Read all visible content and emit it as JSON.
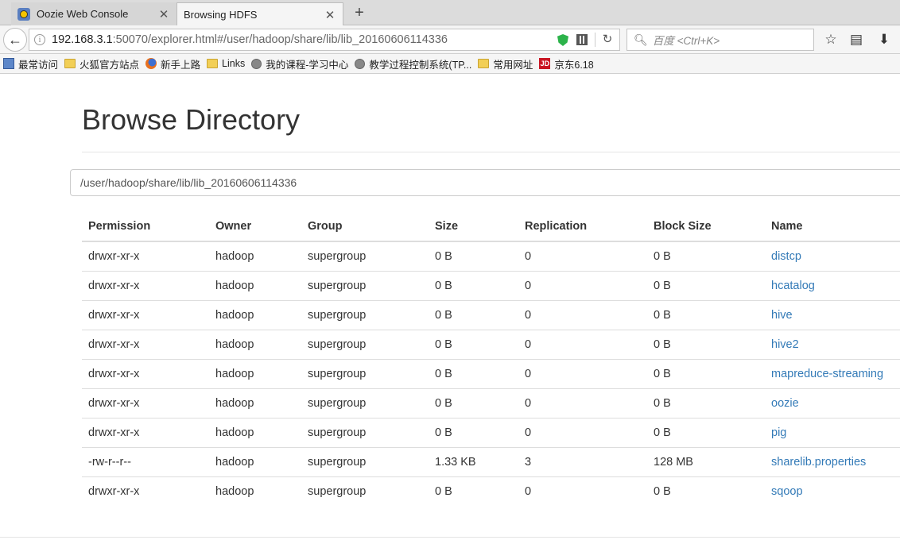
{
  "tabs": [
    {
      "title": "Oozie Web Console",
      "active": false
    },
    {
      "title": "Browsing HDFS",
      "active": true
    }
  ],
  "urlbar": {
    "host": "192.168.3.1",
    "rest": ":50070/explorer.html#/user/hadoop/share/lib/lib_20160606114336"
  },
  "searchbar": {
    "placeholder": "百度 <Ctrl+K>"
  },
  "bookmarks": [
    {
      "label": "最常访问",
      "icon": "most-visited-icon"
    },
    {
      "label": "火狐官方站点",
      "icon": "folder-icon"
    },
    {
      "label": "新手上路",
      "icon": "firefox-icon"
    },
    {
      "label": "Links",
      "icon": "folder-icon"
    },
    {
      "label": "我的课程-学习中心",
      "icon": "globe-icon"
    },
    {
      "label": "教学过程控制系统(TP...",
      "icon": "globe-icon"
    },
    {
      "label": "常用网址",
      "icon": "folder-icon"
    },
    {
      "label": "京东6.18",
      "icon": "jd-icon"
    }
  ],
  "page": {
    "title": "Browse Directory",
    "path": "/user/hadoop/share/lib/lib_20160606114336"
  },
  "table": {
    "headers": [
      "Permission",
      "Owner",
      "Group",
      "Size",
      "Replication",
      "Block Size",
      "Name"
    ],
    "rows": [
      [
        "drwxr-xr-x",
        "hadoop",
        "supergroup",
        "0 B",
        "0",
        "0 B",
        "distcp"
      ],
      [
        "drwxr-xr-x",
        "hadoop",
        "supergroup",
        "0 B",
        "0",
        "0 B",
        "hcatalog"
      ],
      [
        "drwxr-xr-x",
        "hadoop",
        "supergroup",
        "0 B",
        "0",
        "0 B",
        "hive"
      ],
      [
        "drwxr-xr-x",
        "hadoop",
        "supergroup",
        "0 B",
        "0",
        "0 B",
        "hive2"
      ],
      [
        "drwxr-xr-x",
        "hadoop",
        "supergroup",
        "0 B",
        "0",
        "0 B",
        "mapreduce-streaming"
      ],
      [
        "drwxr-xr-x",
        "hadoop",
        "supergroup",
        "0 B",
        "0",
        "0 B",
        "oozie"
      ],
      [
        "drwxr-xr-x",
        "hadoop",
        "supergroup",
        "0 B",
        "0",
        "0 B",
        "pig"
      ],
      [
        "-rw-r--r--",
        "hadoop",
        "supergroup",
        "1.33 KB",
        "3",
        "128 MB",
        "sharelib.properties"
      ],
      [
        "drwxr-xr-x",
        "hadoop",
        "supergroup",
        "0 B",
        "0",
        "0 B",
        "sqoop"
      ]
    ]
  },
  "colors": {
    "link": "#337ab7",
    "text": "#333333",
    "shield": "#2cb34a"
  }
}
